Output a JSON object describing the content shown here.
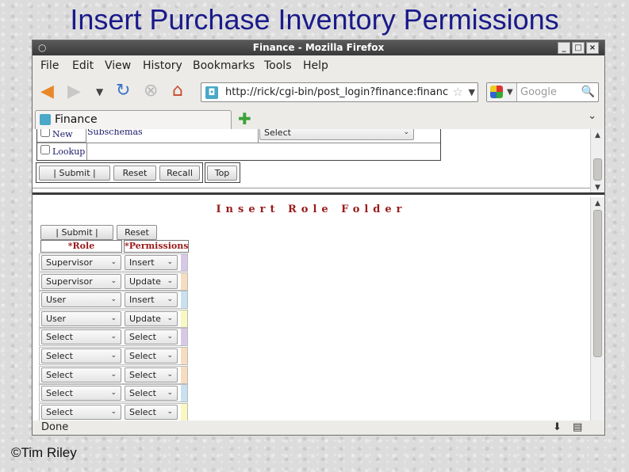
{
  "slide": {
    "title": "Insert Purchase Inventory Permissions",
    "credit": "©Tim Riley"
  },
  "window": {
    "title": "Finance - Mozilla Firefox",
    "controls": [
      "_",
      "□",
      "×"
    ]
  },
  "menu": [
    "File",
    "Edit",
    "View",
    "History",
    "Bookmarks",
    "Tools",
    "Help"
  ],
  "navbar": {
    "url": "http://rick/cgi-bin/post_login?finance:financ",
    "search_placeholder": "Google"
  },
  "tab": {
    "label": "Finance"
  },
  "top_frame": {
    "rows": [
      {
        "checkbox_label": "New",
        "field_label": "Subschemas",
        "select_value": "Select"
      },
      {
        "checkbox_label": "Lookup"
      }
    ],
    "buttons": {
      "submit": "|   Submit   |",
      "reset": "Reset",
      "recall": "Recall",
      "top": "Top"
    }
  },
  "form": {
    "title": "Insert Role Folder",
    "submit_label": "|   Submit   |",
    "reset_label": "Reset",
    "columns": [
      "*Role",
      "*Permissions"
    ],
    "rows": [
      {
        "role": "Supervisor",
        "permission": "Insert",
        "color": "#d8c8e8"
      },
      {
        "role": "Supervisor",
        "permission": "Update",
        "color": "#f8dcc0"
      },
      {
        "role": "User",
        "permission": "Insert",
        "color": "#c8e0f0"
      },
      {
        "role": "User",
        "permission": "Update",
        "color": "#f8f8c0"
      },
      {
        "role": "Select",
        "permission": "Select",
        "color": "#d8c8e8"
      },
      {
        "role": "Select",
        "permission": "Select",
        "color": "#f8dcc0"
      },
      {
        "role": "Select",
        "permission": "Select",
        "color": "#f8dcc0"
      },
      {
        "role": "Select",
        "permission": "Select",
        "color": "#c8e0f0"
      },
      {
        "role": "Select",
        "permission": "Select",
        "color": "#f8f8c0"
      }
    ]
  },
  "status": {
    "text": "Done"
  }
}
